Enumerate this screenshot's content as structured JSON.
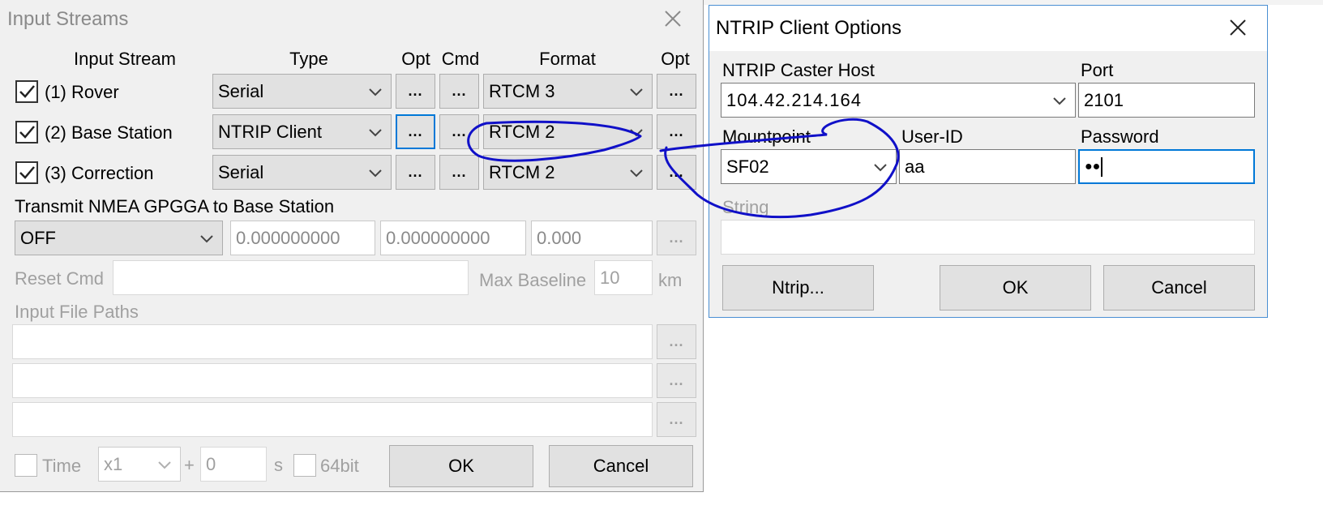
{
  "input_streams": {
    "title": "Input Streams",
    "headers": {
      "input_stream": "Input Stream",
      "type": "Type",
      "opt": "Opt",
      "cmd": "Cmd",
      "format": "Format",
      "opt2": "Opt"
    },
    "rows": [
      {
        "label": "(1) Rover",
        "checked": true,
        "type": "Serial",
        "opt": "...",
        "cmd": "...",
        "format": "RTCM 3",
        "opt2": "..."
      },
      {
        "label": "(2) Base Station",
        "checked": true,
        "type": "NTRIP Client",
        "opt": "...",
        "cmd": "...",
        "format": "RTCM 2",
        "opt2": "..."
      },
      {
        "label": "(3) Correction",
        "checked": true,
        "type": "Serial",
        "opt": "...",
        "cmd": "...",
        "format": "RTCM 2",
        "opt2": "..."
      }
    ],
    "nmea_label": "Transmit NMEA GPGGA to Base Station",
    "nmea_mode": "OFF",
    "nmea_lat": "0.000000000",
    "nmea_lon": "0.000000000",
    "nmea_height": "0.000",
    "nmea_btn": "...",
    "reset_cmd_label": "Reset Cmd",
    "max_baseline_label": "Max Baseline",
    "max_baseline_value": "10",
    "max_baseline_unit": "km",
    "input_file_paths_label": "Input File Paths",
    "path_btn": "...",
    "time_label": "Time",
    "time_speed": "x1",
    "time_plus": "+",
    "time_offset": "0",
    "time_unit": "s",
    "bit64_label": "64bit",
    "ok": "OK",
    "cancel": "Cancel"
  },
  "ntrip": {
    "title": "NTRIP Client Options",
    "host_label": "NTRIP Caster Host",
    "host_value": "104.42.214.164",
    "port_label": "Port",
    "port_value": "2101",
    "mountpoint_label": "Mountpoint",
    "mountpoint_value": "SF02",
    "userid_label": "User-ID",
    "userid_value": "aa",
    "password_label": "Password",
    "password_value": "●●",
    "string_label": "String",
    "ntrip_btn": "Ntrip...",
    "ok": "OK",
    "cancel": "Cancel"
  },
  "colors": {
    "annotation": "#1010c8",
    "focus": "#0078d7"
  },
  "icons": [
    "close-icon",
    "chevron-down-icon",
    "checkmark-icon"
  ]
}
